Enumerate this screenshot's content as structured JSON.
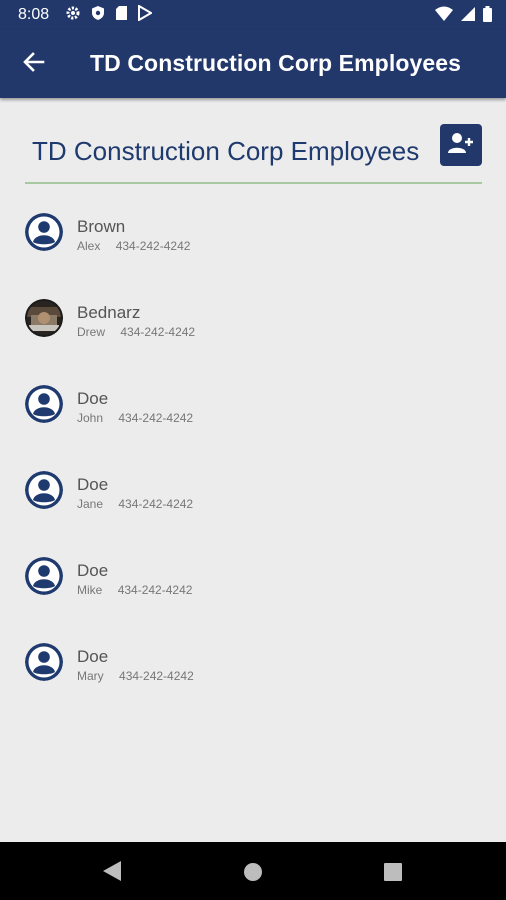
{
  "status_bar": {
    "time": "8:08",
    "left_icons": [
      "gear-icon",
      "shield-icon",
      "sd-card-icon",
      "play-store-icon"
    ],
    "right_icons": [
      "wifi-icon",
      "signal-icon",
      "battery-icon"
    ]
  },
  "app_bar": {
    "title": "TD Construction Corp Employees",
    "back_icon": "arrow-back-icon"
  },
  "header": {
    "title": "TD Construction Corp Employees",
    "add_icon": "add-person-icon"
  },
  "colors": {
    "primary": "#22376a",
    "title_text": "#1f3a6e",
    "divider": "#a8c8a0",
    "background": "#ececec"
  },
  "employees": [
    {
      "last_name": "Brown",
      "first_name": "Alex",
      "phone": "434-242-4242",
      "avatar": "person-icon"
    },
    {
      "last_name": "Bednarz",
      "first_name": "Drew",
      "phone": "434-242-4242",
      "avatar": "photo"
    },
    {
      "last_name": "Doe",
      "first_name": "John",
      "phone": "434-242-4242",
      "avatar": "person-icon"
    },
    {
      "last_name": "Doe",
      "first_name": "Jane",
      "phone": "434-242-4242",
      "avatar": "person-icon"
    },
    {
      "last_name": "Doe",
      "first_name": "Mike",
      "phone": "434-242-4242",
      "avatar": "person-icon"
    },
    {
      "last_name": "Doe",
      "first_name": "Mary",
      "phone": "434-242-4242",
      "avatar": "person-icon"
    }
  ],
  "nav_bar": {
    "icons": [
      "back-triangle-icon",
      "home-circle-icon",
      "recents-square-icon"
    ]
  }
}
